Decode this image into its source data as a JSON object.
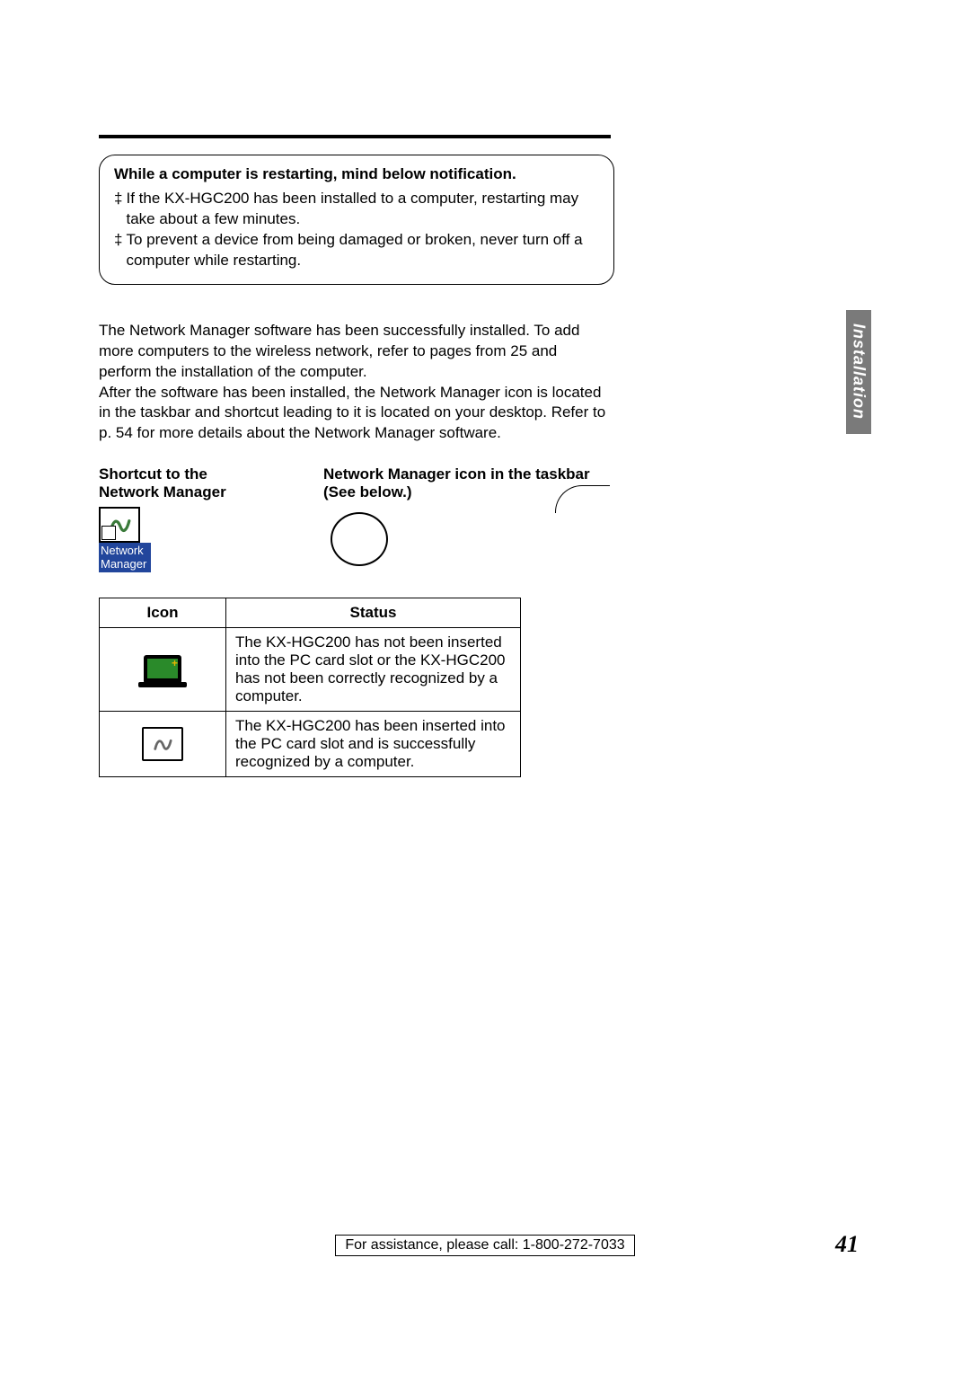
{
  "sideTab": "Installation",
  "notice": {
    "title": "While a computer is restarting, mind below notification.",
    "bullets": [
      "If the KX-HGC200 has been installed to a computer, restarting may take about a few minutes.",
      "To prevent a device from being damaged or broken, never turn off a computer while restarting."
    ]
  },
  "body": "The Network Manager software has been successfully installed. To add more computers to the wireless network, refer to pages from 25 and perform the installation of the computer.\nAfter the software has been installed, the Network Manager icon is located in the taskbar and shortcut leading to it is located on your desktop. Refer to p. 54 for more details about the Network Manager software.",
  "captions": {
    "shortcut": "Shortcut to the Network Manager",
    "taskbar": "Network Manager icon in the taskbar (See below.)"
  },
  "shortcutLabel": "Network Manager",
  "table": {
    "headers": {
      "icon": "Icon",
      "status": "Status"
    },
    "rows": [
      {
        "statusText": "The KX-HGC200 has not been inserted into the PC card slot or the KX-HGC200 has not been correctly recognized by a computer."
      },
      {
        "statusText": "The KX-HGC200 has been inserted into the PC card slot and is successfully recognized by a computer."
      }
    ]
  },
  "footer": {
    "assistance": "For assistance, please call: 1-800-272-7033",
    "pageNumber": "41"
  }
}
